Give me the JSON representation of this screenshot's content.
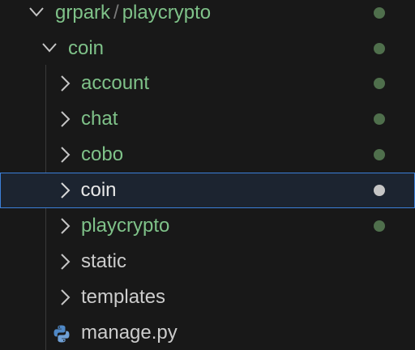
{
  "explorer": {
    "root": {
      "owner": "grpark",
      "separator": "/",
      "repo": "playcrypto",
      "status_color": "#4f6f4c"
    },
    "folder": {
      "label": "coin",
      "status_color": "#4f6f4c"
    },
    "items": [
      {
        "label": "account",
        "kind": "folder",
        "modified": true,
        "selected": false
      },
      {
        "label": "chat",
        "kind": "folder",
        "modified": true,
        "selected": false
      },
      {
        "label": "cobo",
        "kind": "folder",
        "modified": true,
        "selected": false
      },
      {
        "label": "coin",
        "kind": "folder",
        "modified": true,
        "selected": true
      },
      {
        "label": "playcrypto",
        "kind": "folder",
        "modified": true,
        "selected": false
      },
      {
        "label": "static",
        "kind": "folder",
        "modified": false,
        "selected": false
      },
      {
        "label": "templates",
        "kind": "folder",
        "modified": false,
        "selected": false
      },
      {
        "label": "manage.py",
        "kind": "file",
        "icon": "python-icon",
        "modified": false,
        "selected": false
      }
    ],
    "colors": {
      "modified_text": "#7fc289",
      "plain_text": "#cccccc",
      "selection_border": "#3b7fd8",
      "dot_modified": "#4f6f4c",
      "dot_selected": "#c5c5c5",
      "background": "#181818"
    }
  }
}
